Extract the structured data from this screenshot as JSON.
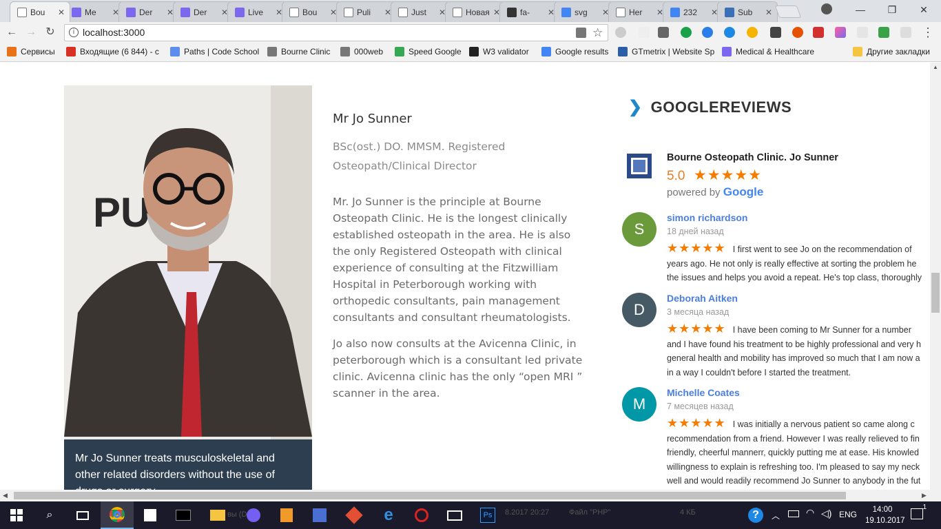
{
  "browser": {
    "tabs": [
      {
        "label": "Bou",
        "color": "#ffffff",
        "icon": "page-icon",
        "active": true
      },
      {
        "label": "Me",
        "color": "#7b68ee",
        "icon": "shield-icon"
      },
      {
        "label": "Der",
        "color": "#7b68ee",
        "icon": "shield-icon"
      },
      {
        "label": "Der",
        "color": "#7b68ee",
        "icon": "shield-icon"
      },
      {
        "label": "Live",
        "color": "#7b68ee",
        "icon": "shield-icon"
      },
      {
        "label": "Bou",
        "color": "#ffffff",
        "icon": "page-icon"
      },
      {
        "label": "Puli",
        "color": "#ffffff",
        "icon": "page-icon"
      },
      {
        "label": "Just",
        "color": "#ffffff",
        "icon": "page-icon"
      },
      {
        "label": "Новая",
        "color": "#ffffff",
        "icon": "page-icon"
      },
      {
        "label": "fa-",
        "color": "#333333",
        "icon": "flag-icon"
      },
      {
        "label": "svg",
        "color": "#4285f4",
        "icon": "google-icon"
      },
      {
        "label": "Her",
        "color": "#ffffff",
        "icon": "page-icon"
      },
      {
        "label": "232",
        "color": "#4285f4",
        "icon": "google-icon"
      },
      {
        "label": "Sub",
        "color": "#3b6fb6",
        "icon": "doc-icon"
      }
    ],
    "url": "localhost:3000",
    "bookmarks": [
      {
        "label": "Сервисы",
        "icon": "apps-icon"
      },
      {
        "label": "Входящие (6 844) - c",
        "icon": "gmail-icon"
      },
      {
        "label": "Paths | Code School",
        "icon": "code-icon"
      },
      {
        "label": "Bourne Clinic",
        "icon": "page-icon"
      },
      {
        "label": "000web",
        "icon": "page-icon"
      },
      {
        "label": "Speed Google",
        "icon": "speed-icon"
      },
      {
        "label": "W3 validator",
        "icon": "w3-icon"
      },
      {
        "label": "Google results",
        "icon": "google-icon"
      },
      {
        "label": "GTmetrix | Website Sp",
        "icon": "gt-icon"
      },
      {
        "label": "Medical & Healthcare",
        "icon": "shield-icon"
      }
    ],
    "other_bookmarks": "Другие закладки"
  },
  "profile": {
    "name": "Mr Jo Sunner",
    "credentials_line1": "BSc(ost.) DO. MMSM. Registered",
    "credentials_line2": "Osteopath/Clinical Director",
    "bio_p1": "Mr. Jo Sunner is the principle at Bourne Osteopath Clinic. He is the longest clinically established osteopath in the area. He is also the only Registered Osteopath with clinical experience of consulting at the Fitzwilliam Hospital in Peterborough working with orthopedic consultants, pain management consultants and consultant rheumatologists.",
    "bio_p2": "Jo also now consults at the Avicenna Clinic, in peterborough which is a consultant led private clinic. Avicenna clinic has the only “open MRI ” scanner in the area.",
    "photo_sign": "PU  E",
    "caption": "Mr Jo Sunner treats musculoskeletal and other related disorders without the use of drugs or surgery"
  },
  "reviews": {
    "heading": "GOOGLEREVIEWS",
    "place_name": "Bourne Osteopath Clinic. Jo Sunner",
    "rating": "5.0",
    "stars": "★★★★★",
    "powered_by": "powered by",
    "google_word": "Google",
    "items": [
      {
        "initial": "S",
        "color": "#6a9a3a",
        "name": "simon richardson",
        "date": "18 дней назад",
        "lines": [
          "I first went to see Jo on the recommendation of",
          "years ago. He not only is really effective at sorting the problem he",
          "the issues and helps you avoid a repeat. He's top class, thoroughly"
        ]
      },
      {
        "initial": "D",
        "color": "#455a64",
        "name": "Deborah Aitken",
        "date": "3 месяца назад",
        "lines": [
          "I have been coming to Mr Sunner for a number",
          "and I have found his treatment to be highly professional and very h",
          "general health and mobility has improved so much that I am now a",
          "in a way I couldn't before I started the treatment."
        ]
      },
      {
        "initial": "M",
        "color": "#0097a7",
        "name": "Michelle Coates",
        "date": "7 месяцев назад",
        "lines": [
          "I was initially a nervous patient so came along c",
          "recommendation from a friend. However I was really relieved to fin",
          "friendly, cheerful mannerr, quickly putting me at ease. His knowled",
          "willingness to explain is refreshing too. I'm pleased to say my neck",
          "well and would readily recommend Jo Sunner to anybody in the fut"
        ]
      }
    ]
  },
  "taskbar": {
    "time": "14:00",
    "date": "19.10.2017",
    "lang": "ENG",
    "notifications": "1",
    "faded_text_1": "8.2017 20:27",
    "faded_text_2": "Файл \"PHP\"",
    "faded_text_3": "4 КБ",
    "faded_text_4": "вы (D:)"
  }
}
